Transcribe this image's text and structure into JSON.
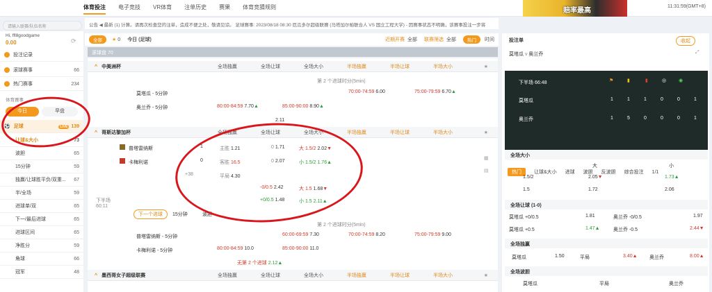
{
  "topnav": [
    "体育投注",
    "电子竞技",
    "VR体育",
    "注单历史",
    "赛果",
    "体育竞猜规则"
  ],
  "banner_text": "赔率最高",
  "clock": "11:31:59(GMT+8)",
  "search_placeholder": "请输入联赛/队伍名称",
  "user": {
    "name": "Hi, ffl8goodgame",
    "balance": "0.00"
  },
  "sidebar": {
    "items": [
      {
        "label": "投注记录",
        "count": ""
      },
      {
        "label": "滚球赛事",
        "count": "66"
      },
      {
        "label": "热门赛事",
        "count": "234"
      }
    ],
    "section": "体育赛事",
    "today": "今日",
    "early": "早盘",
    "football": {
      "label": "足球",
      "count": "139",
      "badge": "LIVE"
    },
    "sub": [
      {
        "label": "让球&大小",
        "count": "73"
      },
      {
        "label": "波胆",
        "count": "65"
      },
      {
        "label": "15分钟",
        "count": "59"
      },
      {
        "label": "独赢/让球胜平负/双重...",
        "count": "67"
      },
      {
        "label": "半/全场",
        "count": "59"
      },
      {
        "label": "进球单/双",
        "count": "65"
      },
      {
        "label": "下一/最后进球",
        "count": "65"
      },
      {
        "label": "进球区间",
        "count": "65"
      },
      {
        "label": "净胜分",
        "count": "59"
      },
      {
        "label": "角球",
        "count": "66"
      },
      {
        "label": "冠军",
        "count": "48"
      }
    ]
  },
  "notice": "公告  ◀ 最新 (1) 计算。请再次检查您的注单，造成不便之处，敬请见谅。    足球赛事: 2023/08/18 08:30 厄瓜多尔超级联赛 (马塔加尔帕联合人 VS 国立工程大学) - 因赛事状态不明确，该赛事投注一步将",
  "filter": {
    "all": "全部",
    "star": "0",
    "title": "今日 (足球)",
    "sort": "近期开赛",
    "sort_value": "全部",
    "league": "联赛筛选",
    "league_value": "全部",
    "hot": "热门",
    "time": "时间"
  },
  "live_header": "滚球盘 70",
  "col_heads": [
    "全场独赢",
    "全场让球",
    "全场大小",
    "半场独赢",
    "半场让球",
    "半场大小"
  ],
  "league1": {
    "name": "中美洲杯",
    "minor_head": "第 2 个进球时分(5min)",
    "rows": [
      {
        "team": "莫塔瓜 - 5分钟",
        "c1": "70:00-74:59",
        "v1": "6.00",
        "c2": "75:00-79:59",
        "v2": "6.70"
      },
      {
        "team": "奥兰乔 - 5分钟",
        "c1": "80:00-84:59",
        "v1": "7.70",
        "c2": "85:00-90:00",
        "v2": "8.90"
      }
    ],
    "tail": "2.11"
  },
  "league2": {
    "name": "哥斯达黎加杯",
    "home": "普塔雷纳斯",
    "away": "卡梅利诺",
    "hscore": "1",
    "ascore": "0",
    "more": "+38",
    "time_label": "下半场",
    "time": "60:11",
    "r1": {
      "h": "主胜",
      "hv": "1.21",
      "hc": "0",
      "hcv": "1.71",
      "ou": "大 1.5/2",
      "ouv": "2.02"
    },
    "r2": {
      "h": "客胜",
      "hv": "16.5",
      "hc": "0",
      "hcv": "2.07",
      "ou": "小 1.5/2",
      "ouv": "1.76"
    },
    "r3": {
      "h": "平局",
      "hv": "4.30"
    },
    "r4": {
      "hc": "-0/0.5",
      "hcv": "2.42",
      "ou": "大 1.5",
      "ouv": "1.68"
    },
    "r5": {
      "hc": "+0/0.5",
      "hcv": "1.48",
      "ou": "小 1.5",
      "ouv": "2.11"
    },
    "subtabs": [
      "下一个进球",
      "15分钟",
      "波胆"
    ],
    "minor_head": "第 2 个进球时分(5min)",
    "m1": {
      "team": "普塔雷纳斯 - 5分钟",
      "c1": "60:00-69:59",
      "v1": "7.30",
      "c2": "70:00-74:59",
      "v2": "8.20",
      "c3": "75:00-79:59",
      "v3": "9.00"
    },
    "m2": {
      "team": "卡梅利诺 - 5分钟",
      "c1": "80:00-84:59",
      "v1": "10.0",
      "c2": "85:00-90:00",
      "v2": "11.0"
    },
    "m3": {
      "c": "无第 2 个进球",
      "v": "2.12"
    }
  },
  "league3": {
    "name": "墨西哥女子超级联赛"
  },
  "right": {
    "tab": "投注单",
    "close": "收起",
    "home": "莫塔瓜",
    "vs": "v",
    "away": "奥兰乔",
    "period": "下半场 66:48",
    "stats_home": [
      "1",
      "1",
      "1",
      "0",
      "0",
      "1"
    ],
    "stats_away": [
      "1",
      "5",
      "0",
      "0",
      "0",
      "1"
    ],
    "tabs": [
      "热门",
      "让球&大小",
      "进球",
      "波胆",
      "反波胆",
      "综合投注",
      "1/1"
    ],
    "ou": {
      "title": "全场大小",
      "big": "大",
      "small": "小",
      "r1": {
        "l": "1.5/2",
        "b": "2.05",
        "s": "1.73"
      },
      "r2": {
        "l": "1.5",
        "b": "1.72",
        "s": "2.06"
      }
    },
    "hc": {
      "title": "全场让球 (1-0)",
      "r1": {
        "ht": "莫塔瓜 +0/0.5",
        "hv": "1.81",
        "at": "奥兰乔 -0/0.5",
        "av": "1.97"
      },
      "r2": {
        "ht": "莫塔瓜 +0.5",
        "hv": "1.47",
        "at": "奥兰乔 -0.5",
        "av": "2.44"
      }
    },
    "wdl": {
      "title": "全场独赢",
      "h": "莫塔瓜",
      "hv": "1.50",
      "d": "平局",
      "dv": "3.40",
      "a": "奥兰乔",
      "av": "8.00"
    },
    "cs": {
      "title": "全场波胆",
      "h": "莫塔瓜",
      "d": "平局",
      "a": "奥兰乔"
    }
  }
}
